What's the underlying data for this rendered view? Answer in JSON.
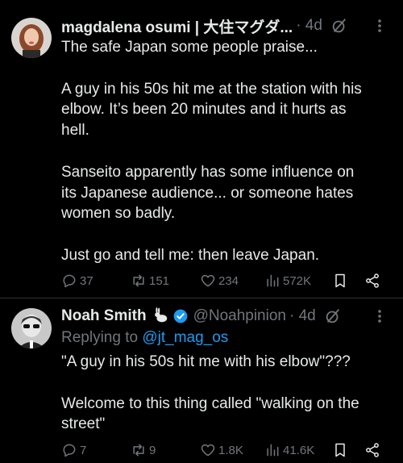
{
  "tweet1": {
    "display_name": "magdalena osumi | 大住マグダ...",
    "time": "· 4d",
    "lines": [
      "The safe Japan some people praise...",
      "",
      "A guy in his 50s hit me at the station with his",
      "elbow. It’s been 20 minutes and it hurts as",
      "hell.",
      "",
      "Sanseito apparently has some influence on",
      "its Japanese audience... or someone hates",
      "women so badly.",
      "",
      "Just go and tell me: then leave Japan."
    ],
    "replies": "37",
    "reposts": "151",
    "likes": "234",
    "views": "572K"
  },
  "tweet2": {
    "display_name": "Noah Smith",
    "handle": "@Noahpinion",
    "time": "· 4d",
    "replying_prefix": "Replying to",
    "replying_handle": "@jt_mag_os",
    "lines": [
      "\"A guy in his 50s hit me with his elbow\"???",
      "",
      "Welcome to this thing called \"walking on the",
      "street\""
    ],
    "replies": "7",
    "reposts": "9",
    "likes": "1.8K",
    "views": "41.6K"
  },
  "colors": {
    "text": "#e7e9ea",
    "muted": "#71767b",
    "link": "#1d9bf0",
    "verified": "#1d9bf0",
    "divider": "#2f3336"
  }
}
